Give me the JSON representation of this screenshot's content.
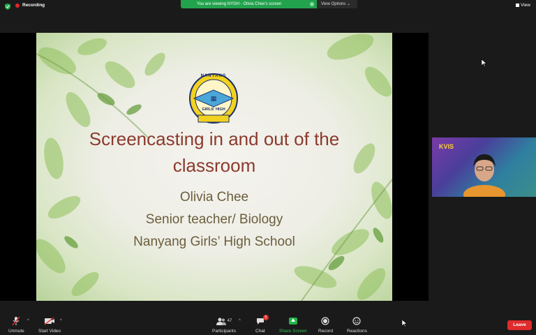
{
  "top_bar": {
    "recording_label": "Recording",
    "banner_text": "You are viewing NYGH - Olivia Chee's screen",
    "view_options_label": "View Options",
    "view_label": "View"
  },
  "slide": {
    "logo_text_top": "NANYANG",
    "logo_text_bottom": "GIRLS' HIGH",
    "title_line1": "Screencasting in and out of the",
    "title_line2": "classroom",
    "presenter": "Olivia Chee",
    "role": "Senior teacher/ Biology",
    "school": "Nanyang Girls’ High School"
  },
  "thumbnail": {
    "brand": "KVIS"
  },
  "bottom_bar": {
    "unmute_label": "Unmute",
    "start_video_label": "Start Video",
    "participants_label": "Participants",
    "participants_count": "47",
    "chat_label": "Chat",
    "chat_badge": "5",
    "share_screen_label": "Share Screen",
    "record_label": "Record",
    "reactions_label": "Reactions",
    "leave_label": "Leave"
  },
  "colors": {
    "accent_green": "#23a24d",
    "leave_red": "#e02b2b",
    "title_red": "#8b3a2d"
  }
}
